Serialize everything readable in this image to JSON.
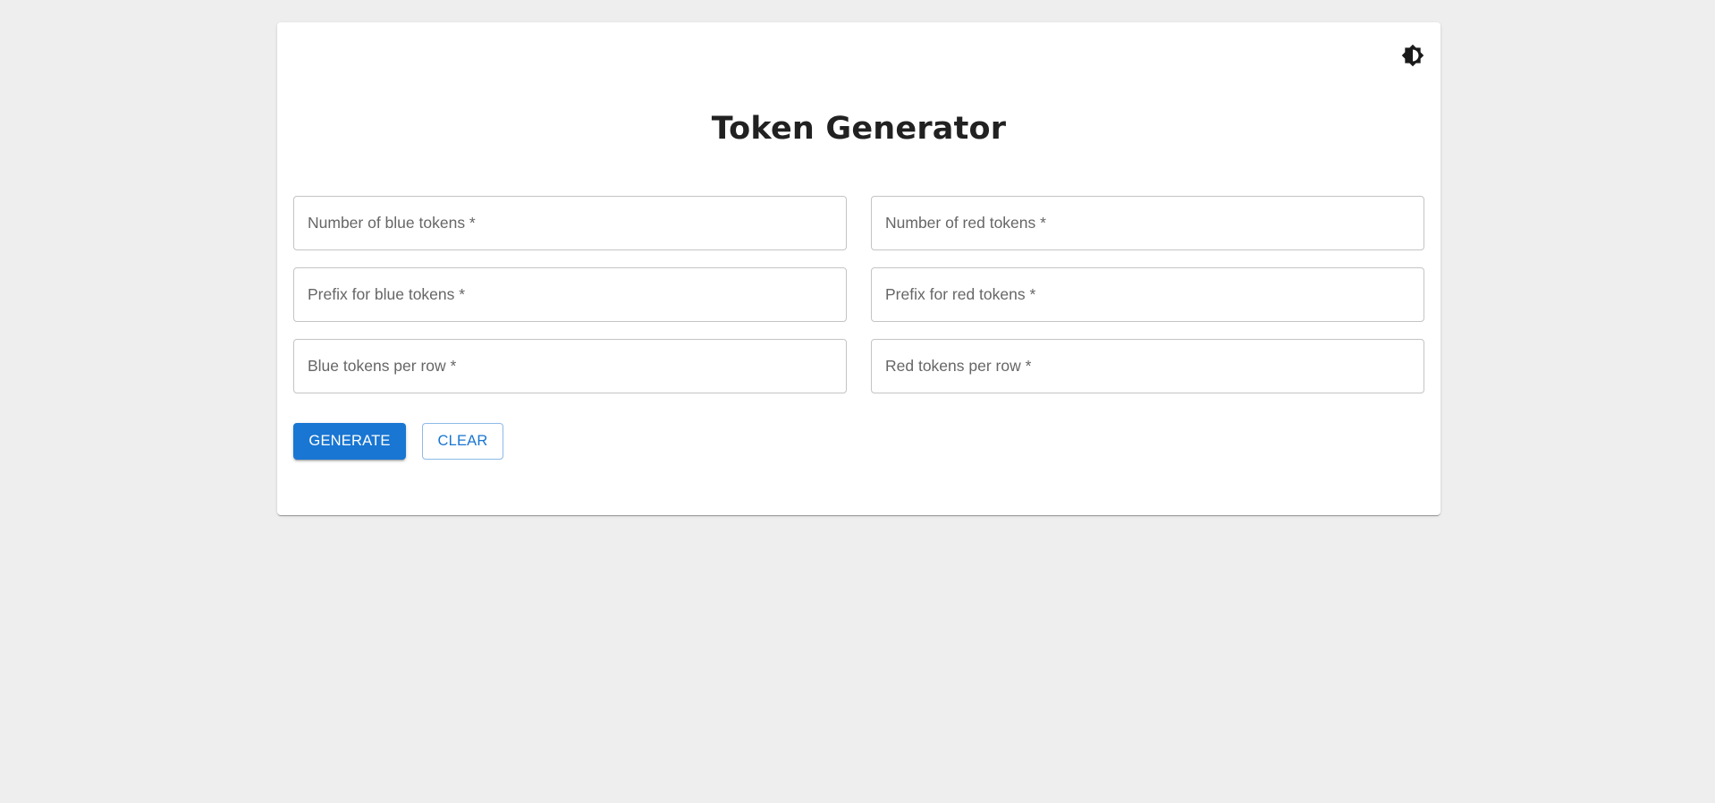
{
  "header": {
    "title": "Token Generator",
    "theme_toggle_icon": "brightness-contrast-icon"
  },
  "form": {
    "fields": [
      {
        "name": "blue-count",
        "placeholder": "Number of blue tokens *",
        "value": ""
      },
      {
        "name": "red-count",
        "placeholder": "Number of red tokens *",
        "value": ""
      },
      {
        "name": "blue-prefix",
        "placeholder": "Prefix for blue tokens *",
        "value": ""
      },
      {
        "name": "red-prefix",
        "placeholder": "Prefix for red tokens *",
        "value": ""
      },
      {
        "name": "blue-per-row",
        "placeholder": "Blue tokens per row *",
        "value": ""
      },
      {
        "name": "red-per-row",
        "placeholder": "Red tokens per row *",
        "value": ""
      }
    ]
  },
  "actions": {
    "generate_label": "GENERATE",
    "clear_label": "CLEAR"
  },
  "colors": {
    "primary": "#1976d2",
    "background": "#eeeeee",
    "card": "#ffffff",
    "title": "#212121"
  }
}
